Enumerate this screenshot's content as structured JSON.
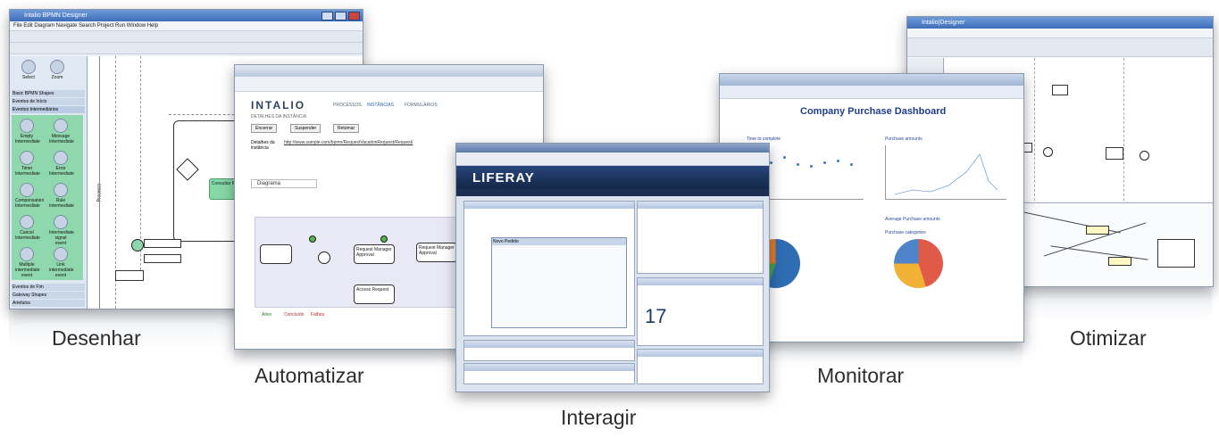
{
  "captions": {
    "desenhar": "Desenhar",
    "automatizar": "Automatizar",
    "interagir": "Interagir",
    "monitorar": "Monitorar",
    "otimizar": "Otimizar"
  },
  "designer": {
    "title": "Intalio BPMN Designer",
    "menu": "File  Edit  Diagram  Navigate  Search  Project  Run  Window  Help",
    "palette": {
      "select": "Select",
      "zoom": "Zoom",
      "basic": "Basic BPMN Shapes",
      "start_events": "Eventos de Início",
      "intermediate_events": "Eventos Intermediários",
      "items": [
        "Empty Intermediate",
        "Message Intermediate",
        "Timer Intermediate",
        "Error Intermediate",
        "Compensation Intermediate",
        "Rule Intermediate",
        "Cancel Intermediate",
        "Intermediate signal event",
        "Multiple intermediate event",
        "Link intermediate event"
      ],
      "end_events": "Eventos de Fim",
      "gateways": "Gateway Shapes",
      "artifacts": "Artefatos"
    },
    "task_label": "Consultar R.H",
    "lane_label": "Processo"
  },
  "console": {
    "logo": "INTALIO",
    "tabs": [
      "PROCESSOS",
      "INSTÂNCIAS",
      "FORMULÁRIOS"
    ],
    "subtitle": "DETALHES DA INSTÂNCIA",
    "buttons": [
      "Encerrar",
      "Suspender",
      "Retomar"
    ],
    "detail_label": "Detalhes da instância",
    "url": "http://www.sample.com/bpmn/RequestVacationRequest/Request/",
    "tab_diagram": "Diagrama",
    "legend": [
      "Ativo",
      "Concluído",
      "Falhou"
    ],
    "tasks": [
      "Request Manager Approval",
      "Request Manager Approval",
      "Access Request"
    ]
  },
  "portal": {
    "logo": "LIFERAY",
    "calendar_day": "17",
    "dialog_title": "Novo Pedido"
  },
  "dashboard": {
    "title": "Company Purchase Dashboard",
    "chart_titles": [
      "Time to complete",
      "Purchase amounts",
      "Average Purchase amounts",
      "Purchase categories"
    ]
  },
  "optimizer": {
    "title": "Intalio|Designer"
  }
}
